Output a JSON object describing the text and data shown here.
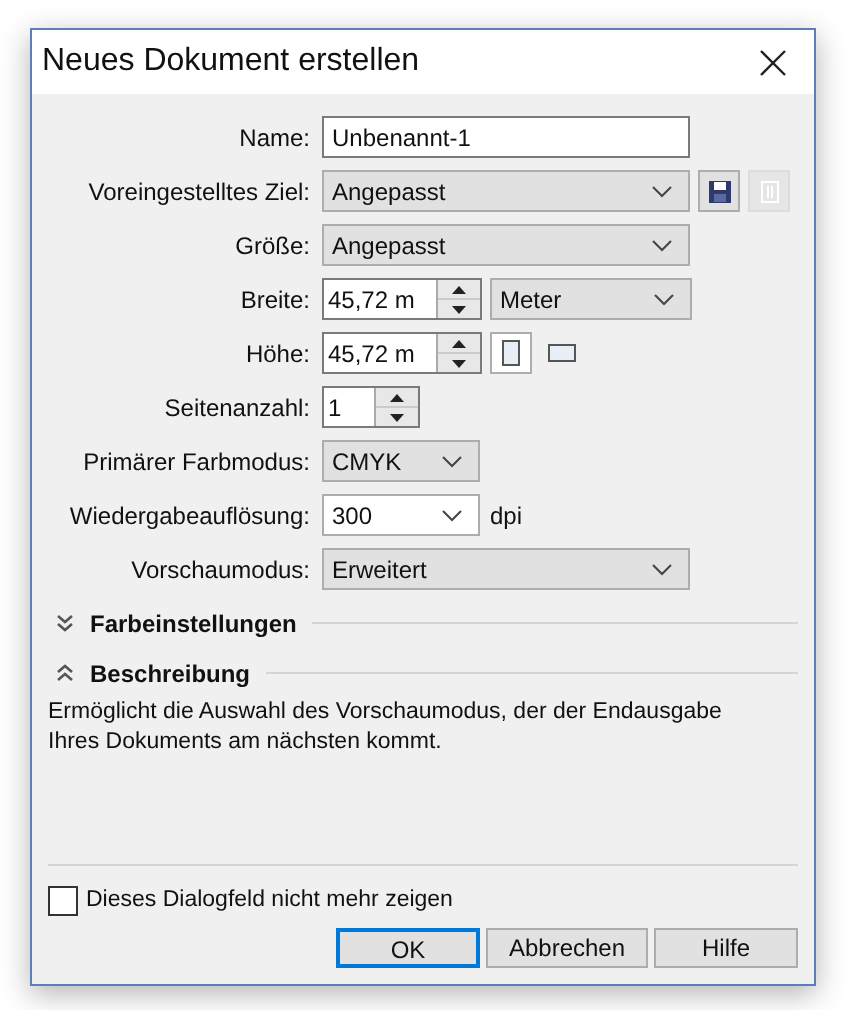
{
  "window": {
    "title": "Neues Dokument erstellen"
  },
  "fields": [
    {
      "kind": "text",
      "label": "Name:",
      "value": "Unbenannt-1"
    },
    {
      "kind": "select",
      "label": "Voreingestelltes Ziel:",
      "value": "Angepasst",
      "preset_buttons": [
        {
          "kind": "save",
          "disabled": false
        },
        {
          "kind": "delete",
          "disabled": true
        }
      ]
    },
    {
      "kind": "select",
      "label": "Größe:",
      "value": "Angepasst"
    },
    {
      "kind": "spin",
      "label": "Breite:",
      "value": "45,72 m",
      "unit_select": "Meter"
    },
    {
      "kind": "spin",
      "label": "Höhe:",
      "value": "45,72 m",
      "orientations": [
        {
          "kind": "portrait",
          "selected": true
        },
        {
          "kind": "landscape",
          "selected": false
        }
      ]
    },
    {
      "kind": "small-spin",
      "label": "Seitenanzahl:",
      "value": "1"
    },
    {
      "kind": "small-select",
      "label": "Primärer Farbmodus:",
      "value": "CMYK"
    },
    {
      "kind": "combo",
      "label": "Wiedergabeauflösung:",
      "value": "300",
      "unit": "dpi"
    },
    {
      "kind": "select",
      "label": "Vorschaumodus:",
      "value": "Erweitert"
    }
  ],
  "sections": [
    {
      "label": "Farbeinstellungen",
      "expanded": false
    },
    {
      "label": "Beschreibung",
      "expanded": true,
      "text": "Ermöglicht die Auswahl des Vorschaumodus, der der Endausgabe Ihres Dokuments am nächsten kommt."
    }
  ],
  "checkbox": {
    "label": "Dieses Dialogfeld nicht mehr zeigen",
    "checked": false
  },
  "buttons": [
    {
      "label": "OK",
      "default": true
    },
    {
      "label": "Abbrechen",
      "default": false
    },
    {
      "label": "Hilfe",
      "default": false
    }
  ]
}
